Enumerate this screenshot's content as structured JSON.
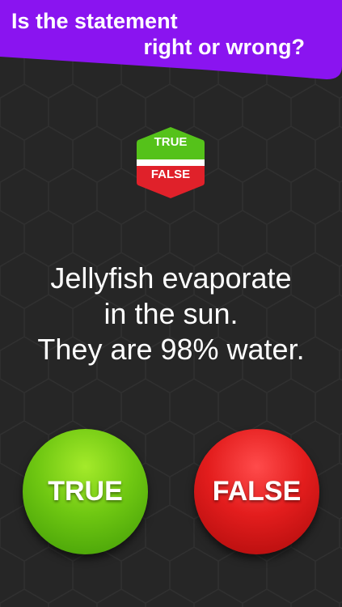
{
  "header": {
    "line1": "Is the statement",
    "line2": "right or wrong?"
  },
  "logo": {
    "true_label": "TRUE",
    "false_label": "FALSE"
  },
  "question": {
    "lines": [
      "Jellyfish evaporate",
      "in the sun.",
      "They are 98% water."
    ]
  },
  "buttons": {
    "true_label": "TRUE",
    "false_label": "FALSE"
  },
  "colors": {
    "banner": "#8a14f0",
    "background": "#262626",
    "true_green": "#6fc712",
    "false_red": "#e31d1d"
  }
}
